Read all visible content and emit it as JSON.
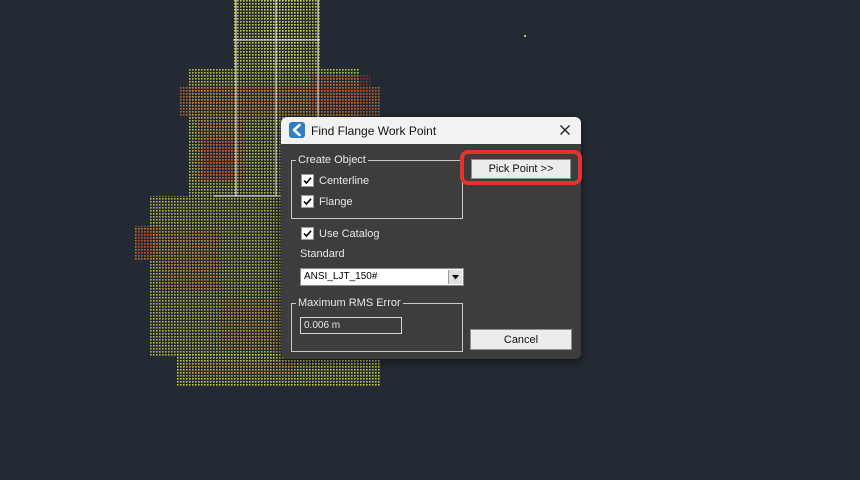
{
  "dialog": {
    "title": "Find Flange Work Point",
    "icon": "app-logo-icon",
    "close_icon": "close-icon"
  },
  "create_object": {
    "legend": "Create Object",
    "centerline": {
      "label": "Centerline",
      "checked": true
    },
    "flange": {
      "label": "Flange",
      "checked": true
    }
  },
  "use_catalog": {
    "label": "Use Catalog",
    "checked": true
  },
  "standard": {
    "label": "Standard",
    "selected": "ANSI_LJT_150#"
  },
  "max_rms": {
    "legend": "Maximum RMS Error",
    "value": "0.006 m"
  },
  "buttons": {
    "pick_point": "Pick Point >>",
    "cancel": "Cancel"
  },
  "colors": {
    "background": "#242a33",
    "dialog_body": "#3d3d3d",
    "titlebar": "#f2f2f2",
    "highlight": "#e7312d"
  }
}
